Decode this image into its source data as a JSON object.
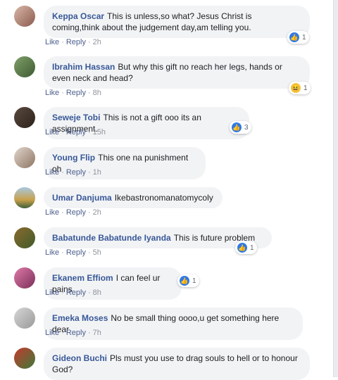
{
  "actions": {
    "like": "Like",
    "reply": "Reply"
  },
  "comments": [
    {
      "name": "Keppa Oscar",
      "text": "This is unless,so what? Jesus Christ is coming,think about the judgement day,am telling you.",
      "time": "2h",
      "reaction": {
        "type": "like-icon",
        "count": "1"
      }
    },
    {
      "name": "Ibrahim Hassan",
      "text": "But why this gift no reach her legs, hands or even neck and head?",
      "time": "8h",
      "reaction": {
        "type": "haha-icon",
        "count": "1"
      }
    },
    {
      "name": "Seweje Tobi",
      "text": "This is not a gift ooo its an assignment.",
      "time": "15h",
      "reaction": {
        "type": "like-icon",
        "count": "3"
      }
    },
    {
      "name": "Young Flip",
      "text": "This one na punishment oh",
      "time": "1h"
    },
    {
      "name": "Umar Danjuma",
      "text": "Ikebastronomanatomycoly",
      "time": "2h"
    },
    {
      "name": "Babatunde Babatunde Iyanda",
      "text": "This is future problem",
      "time": "5h",
      "reaction": {
        "type": "like-icon",
        "count": "1"
      }
    },
    {
      "name": "Ekanem Effiom",
      "text": "I can feel ur pains",
      "time": "8h",
      "reaction": {
        "type": "like-icon",
        "count": "1"
      }
    },
    {
      "name": "Emeka Moses",
      "text": "No be small thing oooo,u get something here dear",
      "time": "7h"
    },
    {
      "name": "Gideon Buchi",
      "text": "Pls must you use to drag souls to hell or to honour God?"
    }
  ]
}
